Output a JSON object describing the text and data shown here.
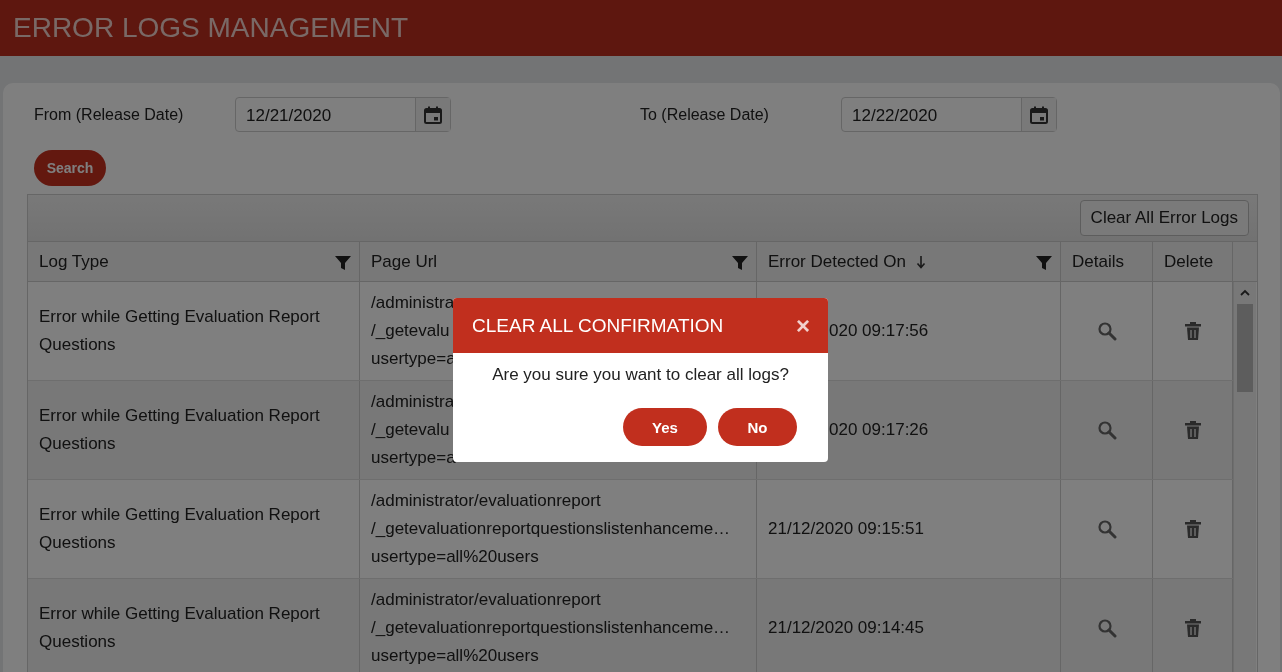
{
  "header": {
    "title": "ERROR LOGS MANAGEMENT"
  },
  "filters": [
    {
      "label": "From (Release Date)",
      "value": "12/21/2020"
    },
    {
      "label": "To (Release Date)",
      "value": "12/22/2020"
    }
  ],
  "search_button": "Search",
  "toolbar": {
    "button": "Clear All Error Logs"
  },
  "table": {
    "columns": [
      {
        "label": "Log Type",
        "filter": true,
        "sorted_desc": false
      },
      {
        "label": "Page Url",
        "filter": true,
        "sorted_desc": false
      },
      {
        "label": "Error Detected On",
        "filter": true,
        "sorted_desc": true
      },
      {
        "label": "Details",
        "filter": false,
        "sorted_desc": false
      },
      {
        "label": "Delete",
        "filter": false,
        "sorted_desc": false
      }
    ],
    "rows": [
      {
        "kind": "covered",
        "log_type": "Error while Getting Evaluation Report Questions",
        "page_url": [
          "/administra",
          "/_getevalu",
          "usertype=a"
        ],
        "detected_on": "020 09:17:56"
      },
      {
        "kind": "covered",
        "log_type": "Error while Getting Evaluation Report Questions",
        "page_url": [
          "/administra",
          "/_getevalu",
          "usertype=a"
        ],
        "detected_on": "020 09:17:26"
      },
      {
        "kind": "full",
        "log_type": "Error while Getting Evaluation Report Questions",
        "page_url": [
          "/administrator/evaluationreport",
          "/_getevaluationreportquestionslistenhanceme…",
          "usertype=all%20users"
        ],
        "detected_on": "21/12/2020 09:15:51"
      },
      {
        "kind": "full",
        "log_type": "Error while Getting Evaluation Report Questions",
        "page_url": [
          "/administrator/evaluationreport",
          "/_getevaluationreportquestionslistenhanceme…",
          "usertype=all%20users"
        ],
        "detected_on": "21/12/2020 09:14:45"
      }
    ]
  },
  "dialog": {
    "title": "CLEAR ALL CONFIRMATION",
    "close": "×",
    "message": "Are you sure you want to clear all logs?",
    "buttons": [
      "Yes",
      "No"
    ]
  }
}
